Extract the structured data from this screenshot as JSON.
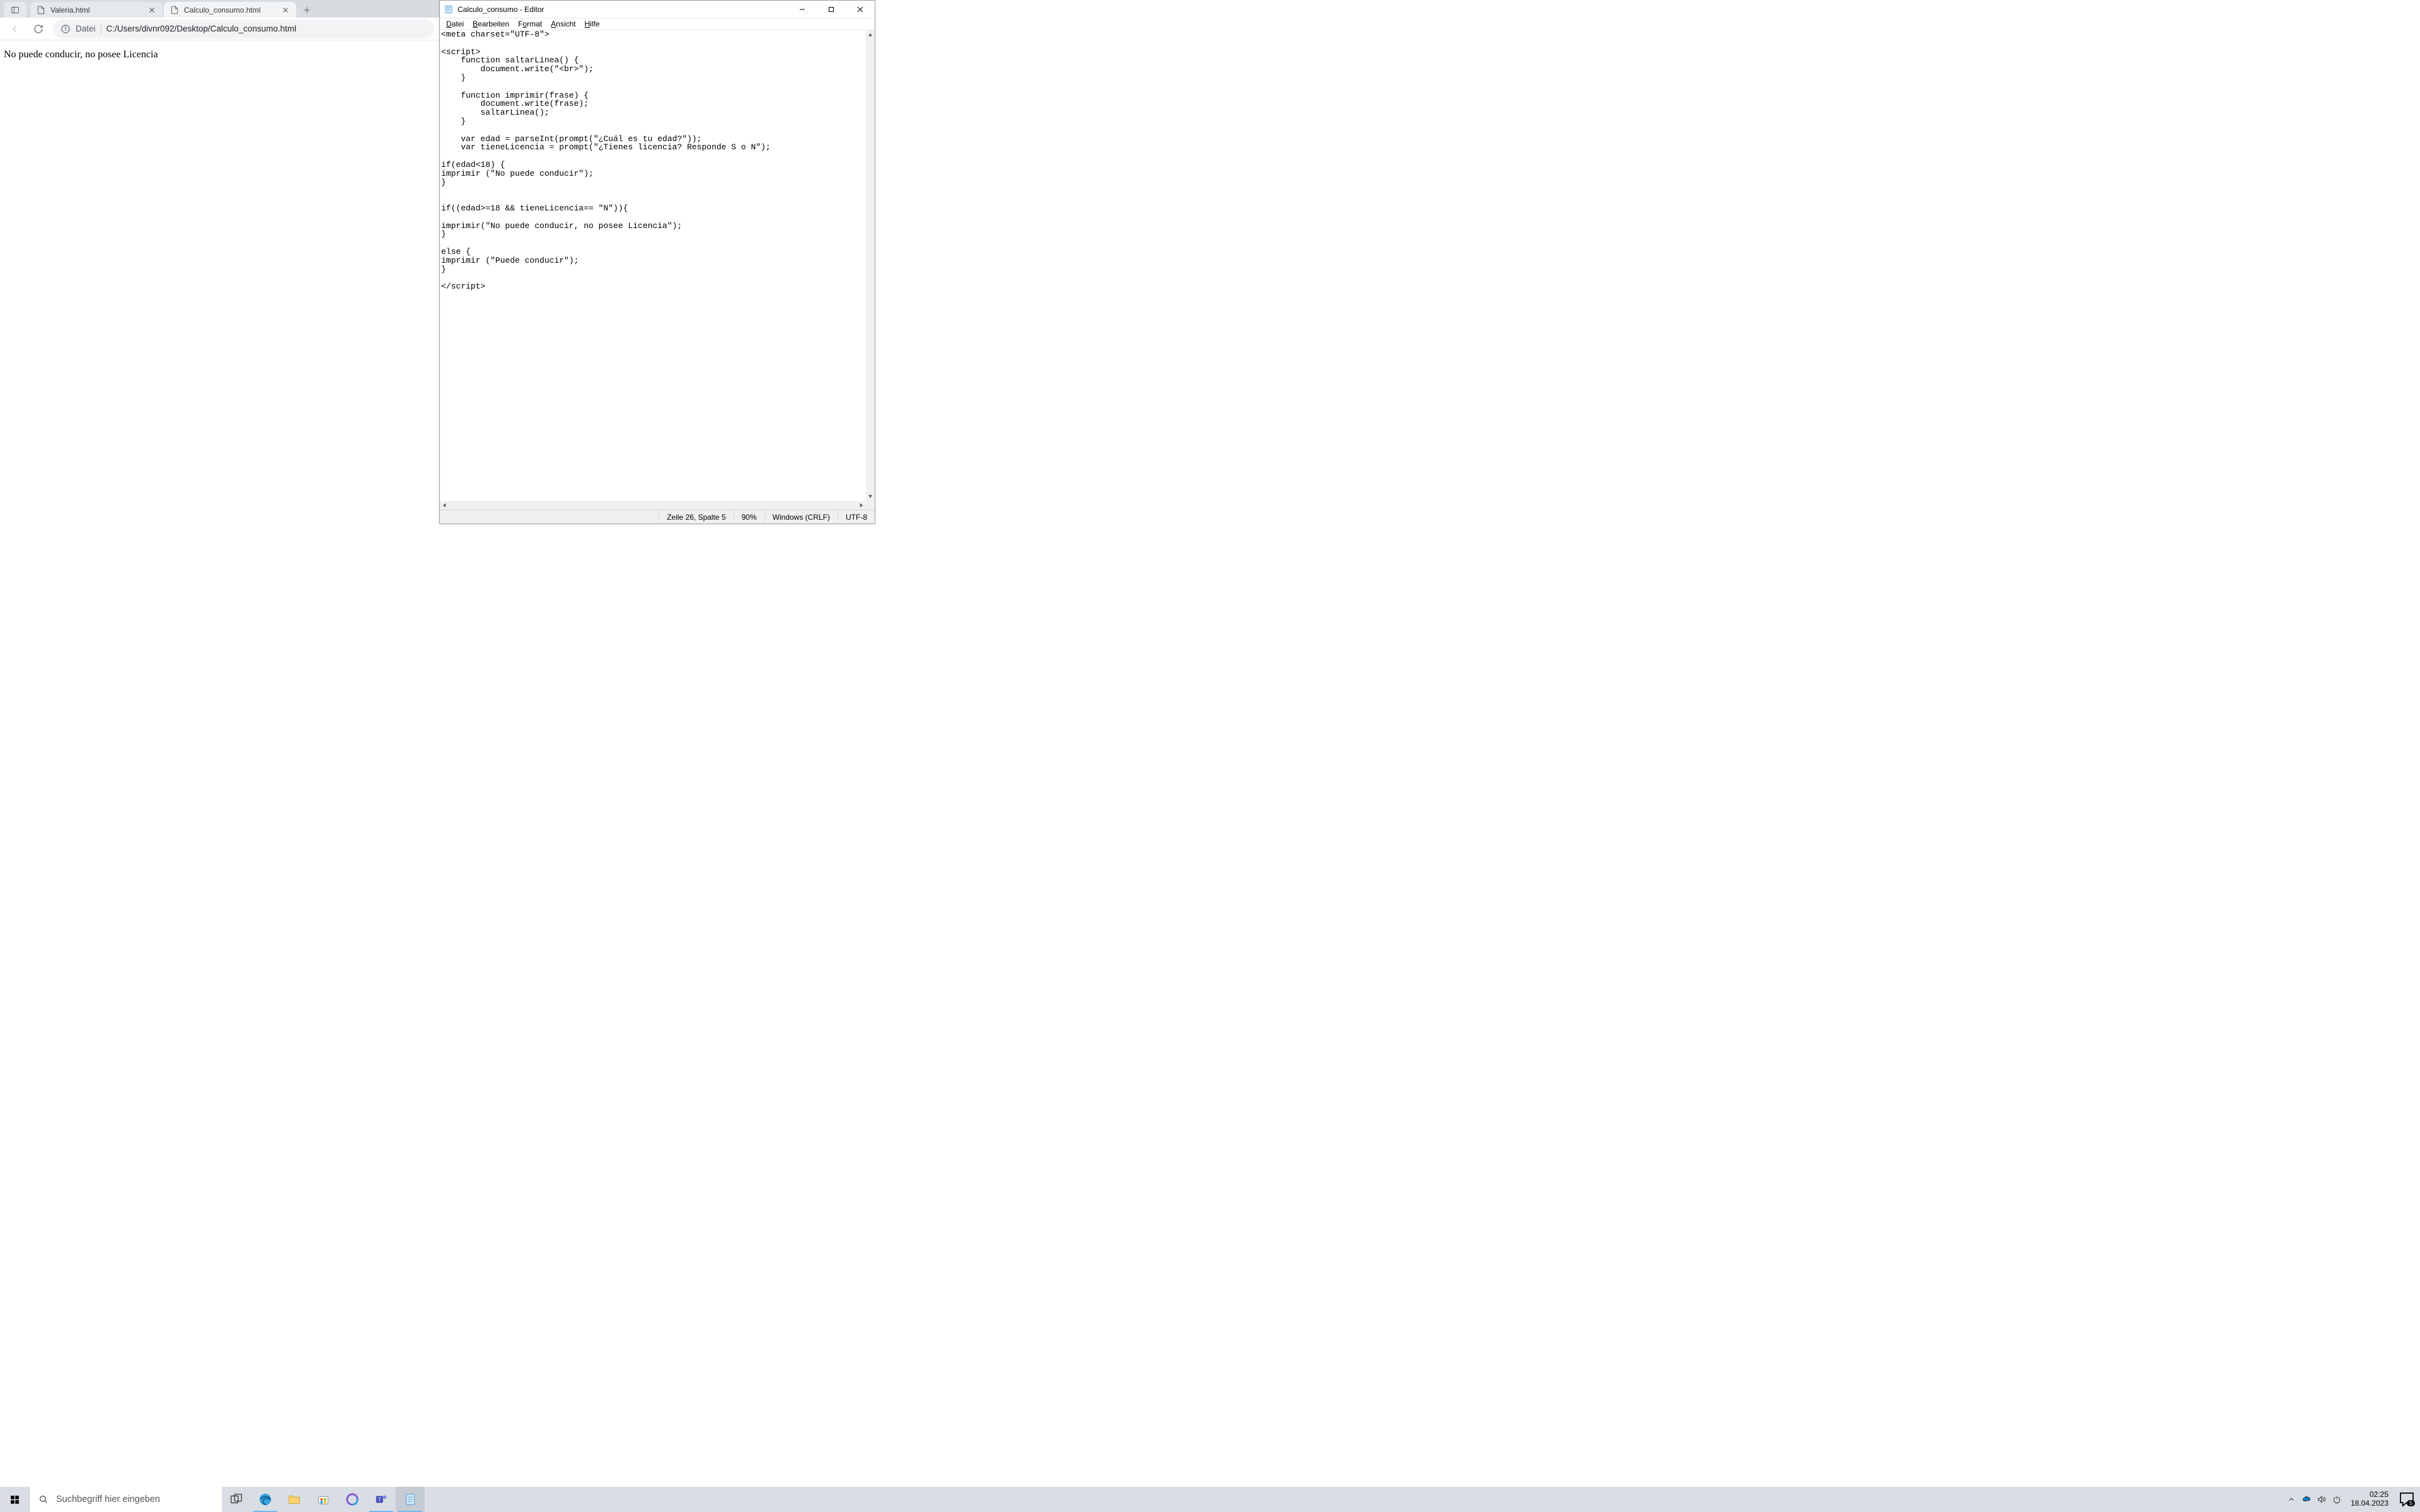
{
  "browser": {
    "tabs": [
      {
        "title": "Valeria.html",
        "active": false
      },
      {
        "title": "Calculo_consumo.html",
        "active": true
      }
    ],
    "omnibox": {
      "scheme": "Datei",
      "path": "C:/Users/divnr092/Desktop/Calculo_consumo.html"
    },
    "page_text": "No puede conducir, no posee Licencia"
  },
  "notepad": {
    "title": "Calculo_consumo - Editor",
    "menus": [
      "Datei",
      "Bearbeiten",
      "Format",
      "Ansicht",
      "Hilfe"
    ],
    "code": "<meta charset=\"UTF-8\">\n\n<script>\n    function saltarLinea() {\n        document.write(\"<br>\");\n    }\n\n    function imprimir(frase) {\n        document.write(frase);\n        saltarLinea();\n    }\n\n    var edad = parseInt(prompt(\"¿Cuál es tu edad?\"));\n    var tieneLicencia = prompt(\"¿Tienes licencia? Responde S o N\");\n\nif(edad<18) {\nimprimir (\"No puede conducir\");\n}\n\n\nif((edad>=18 && tieneLicencia== \"N\")){\n\nimprimir(\"No puede conducir, no posee Licencia\");\n}\n\nelse {\nimprimir (\"Puede conducir\");\n}\n\n</script>",
    "status": {
      "position": "Zeile 26, Spalte 5",
      "zoom": "90%",
      "line_ending": "Windows (CRLF)",
      "encoding": "UTF-8"
    }
  },
  "taskbar": {
    "search_placeholder": "Suchbegriff hier eingeben",
    "clock_time": "02:25",
    "clock_date": "18.04.2023",
    "action_center_count": "5"
  }
}
